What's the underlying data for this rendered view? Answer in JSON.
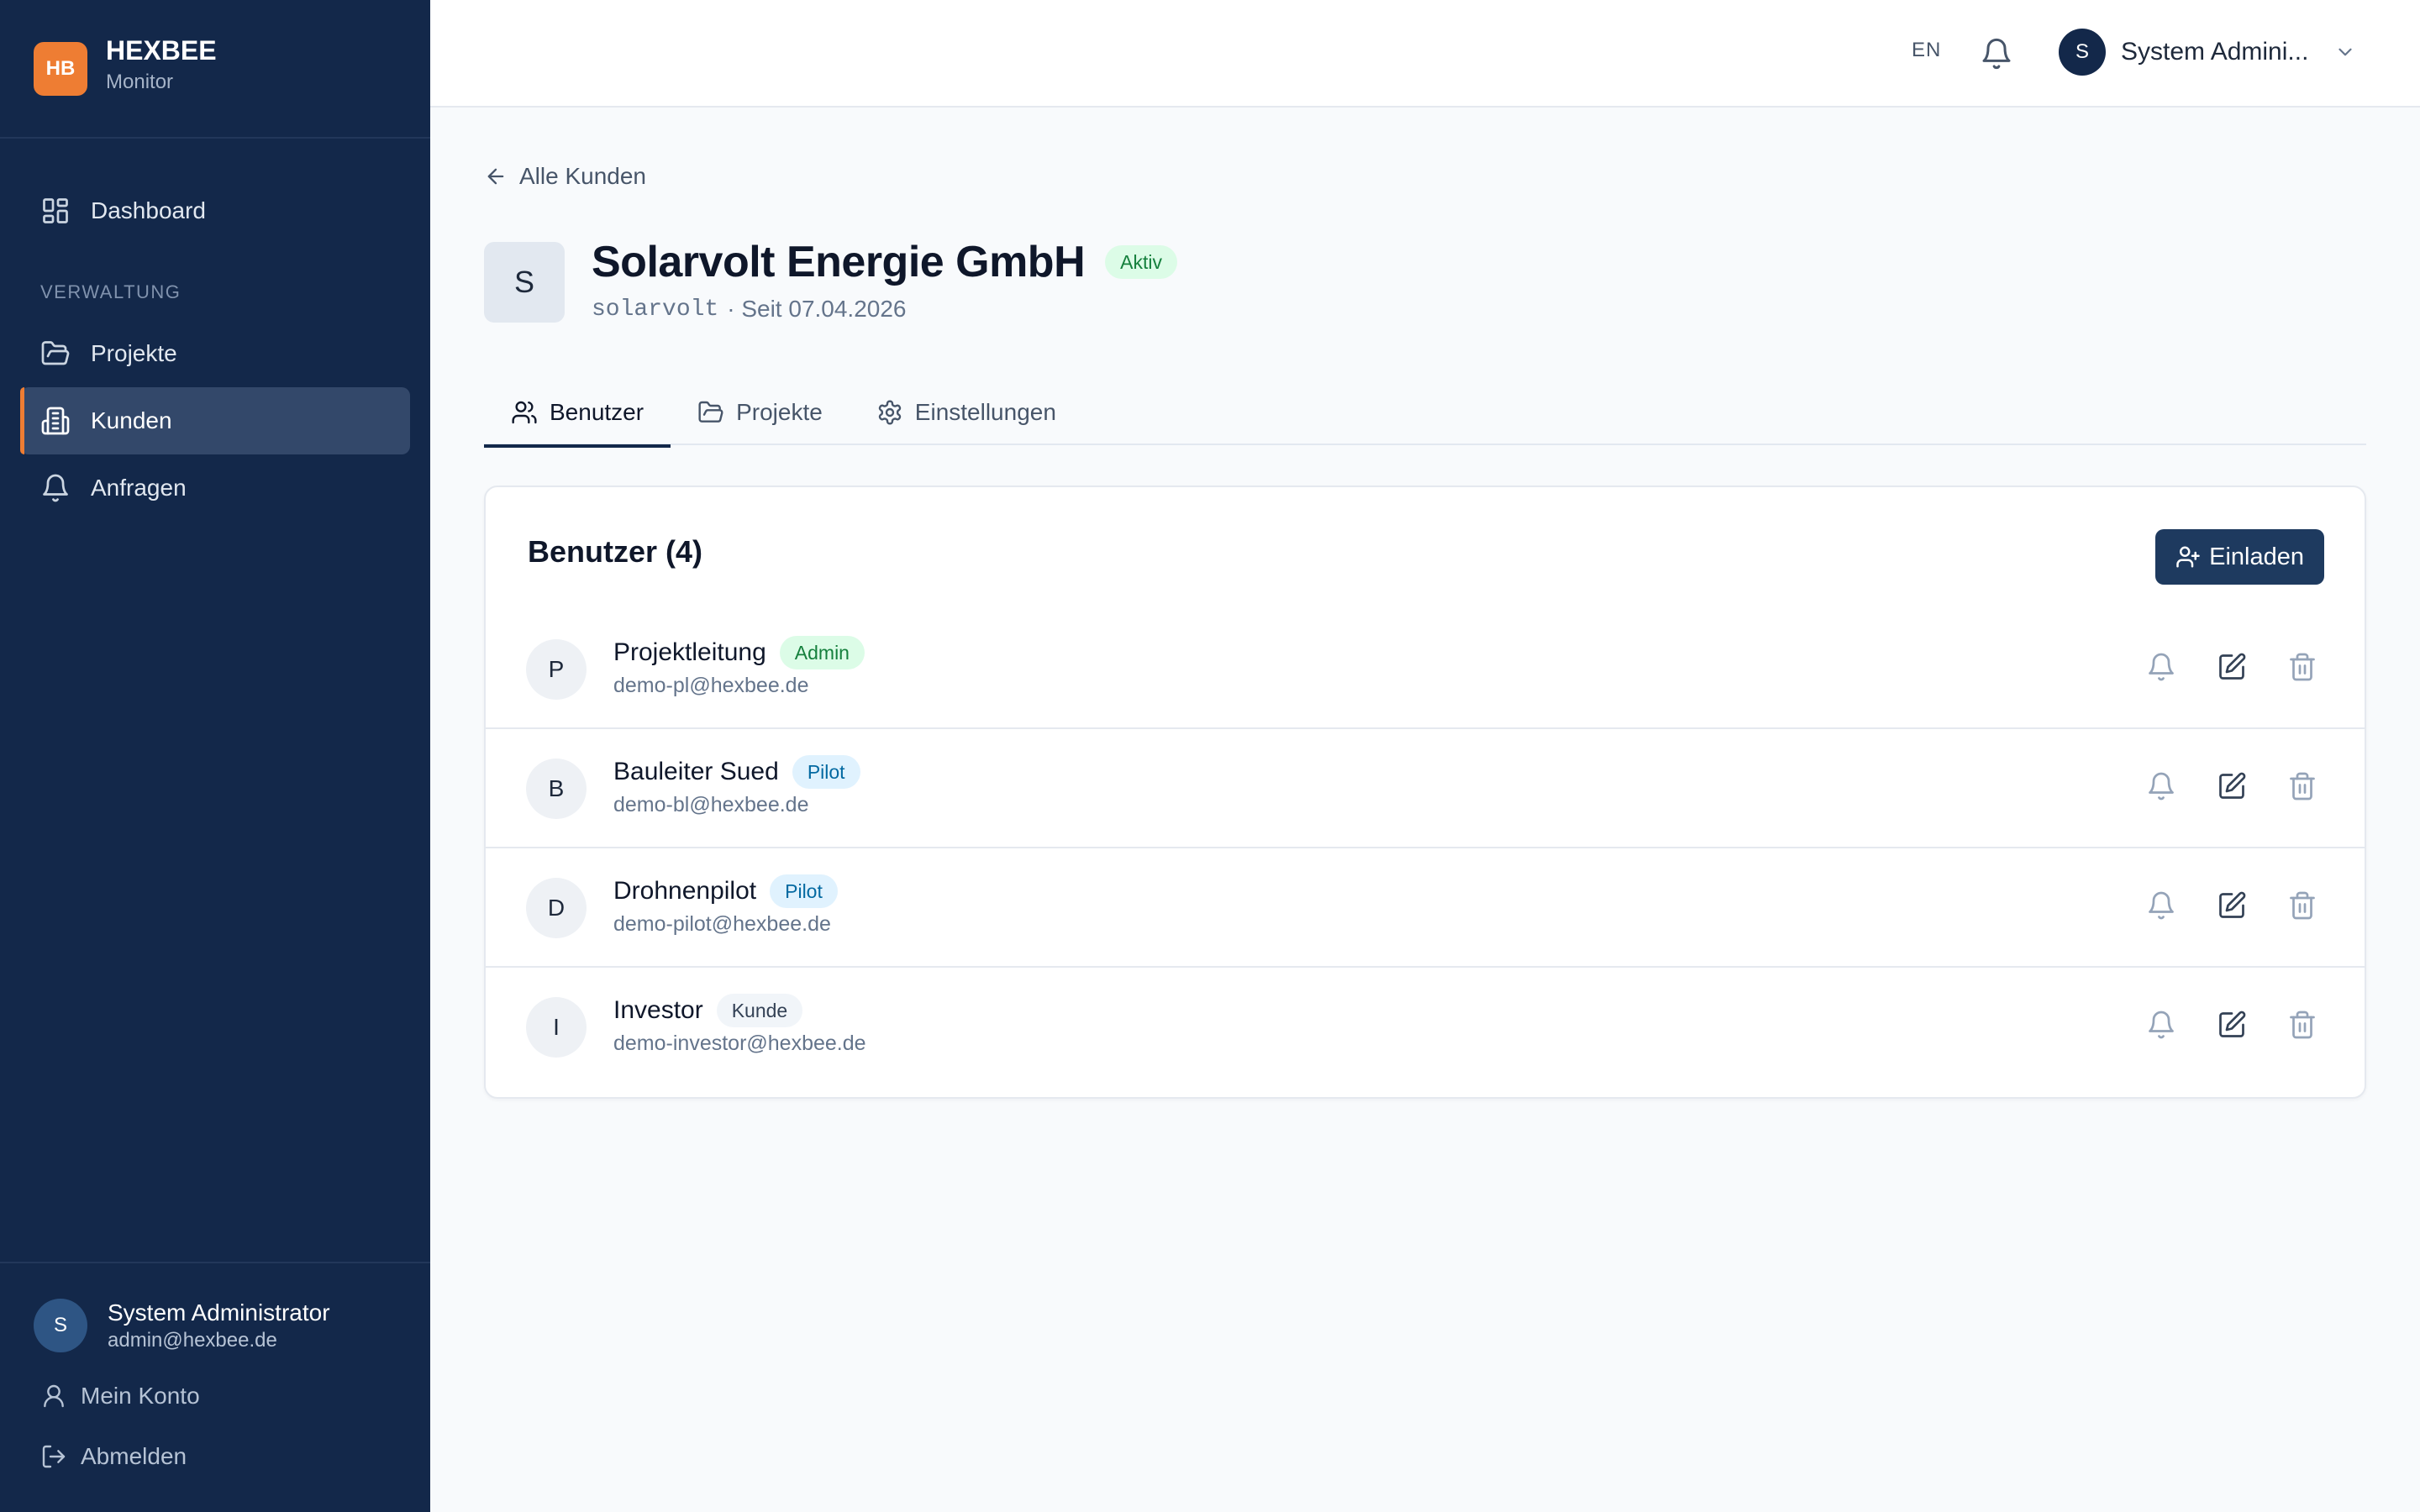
{
  "brand": {
    "logo": "HB",
    "name": "HEXBEE",
    "sub": "Monitor"
  },
  "sidebar": {
    "items": [
      {
        "label": "Dashboard",
        "icon": "dashboard-icon"
      },
      {
        "label": "Projekte",
        "icon": "folder-icon"
      },
      {
        "label": "Kunden",
        "icon": "building-icon",
        "active": true
      },
      {
        "label": "Anfragen",
        "icon": "bell-icon"
      }
    ],
    "section_label": "VERWALTUNG",
    "footer": {
      "avatar": "S",
      "name": "System Administrator",
      "email": "admin@hexbee.de",
      "account_label": "Mein Konto",
      "logout_label": "Abmelden"
    }
  },
  "topbar": {
    "lang": "EN",
    "avatar": "S",
    "user_name": "System Admini..."
  },
  "back_label": "Alle Kunden",
  "customer": {
    "avatar": "S",
    "name": "Solarvolt Energie GmbH",
    "status": "Aktiv",
    "slug": "solarvolt",
    "since": "· Seit 07.04.2026"
  },
  "tabs": [
    {
      "label": "Benutzer",
      "active": true
    },
    {
      "label": "Projekte"
    },
    {
      "label": "Einstellungen"
    }
  ],
  "users_card": {
    "title": "Benutzer (4)",
    "invite_label": "Einladen",
    "rows": [
      {
        "avatar": "P",
        "name": "Projektleitung",
        "role": "Admin",
        "email": "demo-pl@hexbee.de"
      },
      {
        "avatar": "B",
        "name": "Bauleiter Sued",
        "role": "Pilot",
        "email": "demo-bl@hexbee.de"
      },
      {
        "avatar": "D",
        "name": "Drohnenpilot",
        "role": "Pilot",
        "email": "demo-pilot@hexbee.de"
      },
      {
        "avatar": "I",
        "name": "Investor",
        "role": "Kunde",
        "email": "demo-investor@hexbee.de"
      }
    ]
  },
  "colors": {
    "sidebar": "#13284a",
    "accent": "#ee7d33",
    "primary_button": "#1e3a5f"
  }
}
